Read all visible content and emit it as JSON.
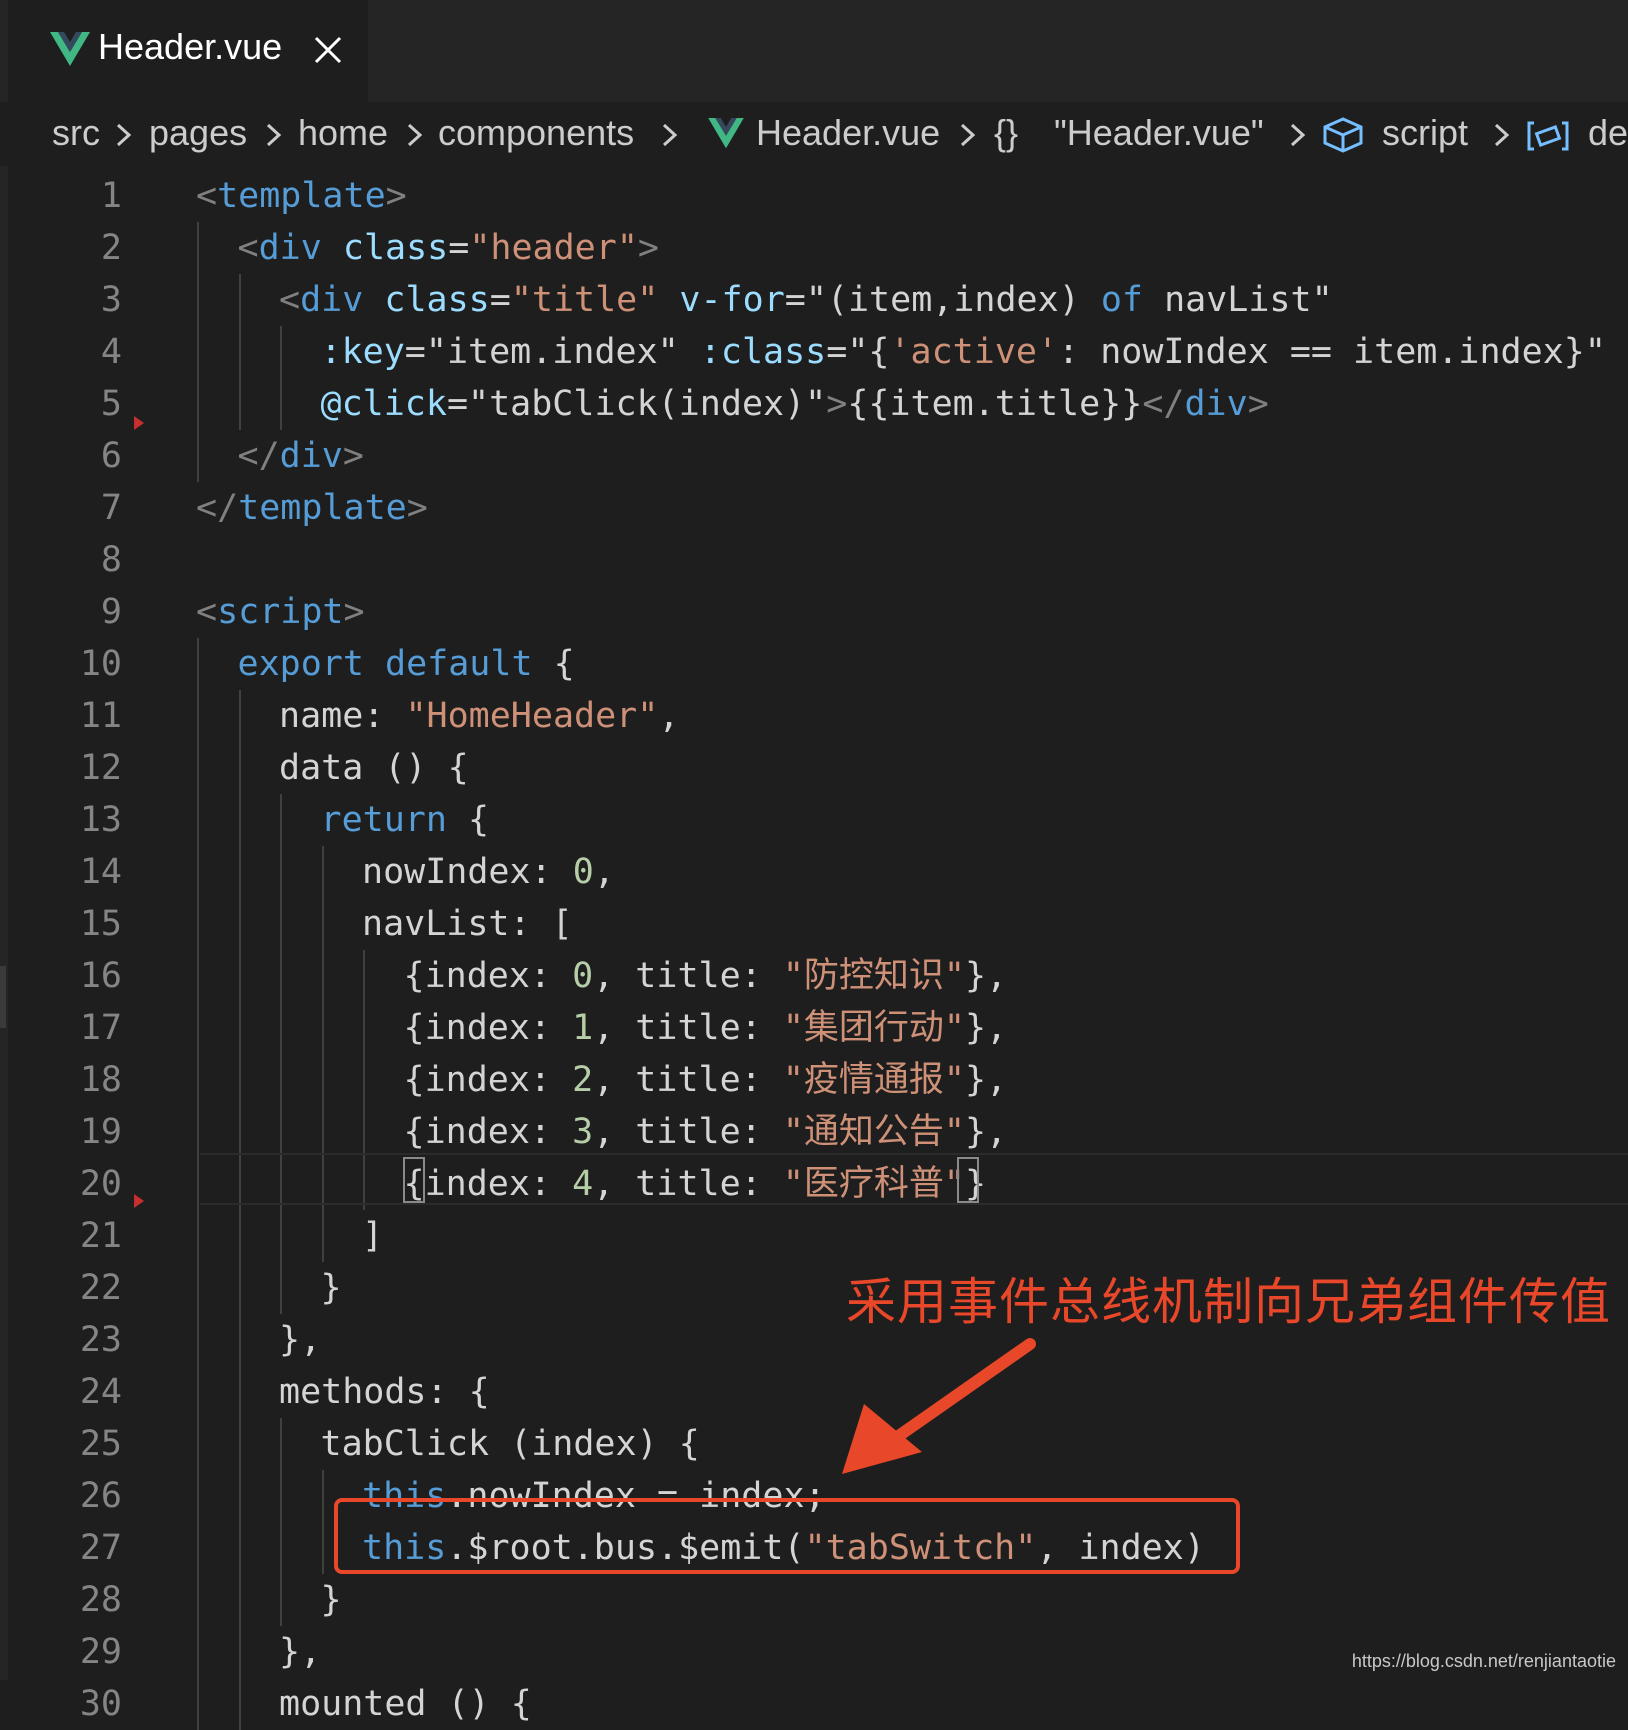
{
  "tab": {
    "label": "Header.vue",
    "vue_icon": "vue-logo-icon",
    "close_icon": "close-icon"
  },
  "breadcrumb": {
    "items": [
      "src",
      "pages",
      "home",
      "components",
      "Header.vue",
      "{}",
      "\"Header.vue\"",
      "script",
      "de"
    ]
  },
  "colors": {
    "annotation": "#e8472a",
    "vue_green": "#41b883",
    "background": "#1e1e1e"
  },
  "lines": [
    {
      "n": "1",
      "indent": 0,
      "tokens": [
        [
          "t-tag",
          "<"
        ],
        [
          "t-name",
          "template"
        ],
        [
          "t-tag",
          ">"
        ]
      ]
    },
    {
      "n": "2",
      "indent": 1,
      "tokens": [
        [
          "t-tag",
          "<"
        ],
        [
          "t-name",
          "div"
        ],
        [
          "t-prop",
          " "
        ],
        [
          "t-attr",
          "class"
        ],
        [
          "t-prop",
          "="
        ],
        [
          "t-str",
          "\"header\""
        ],
        [
          "t-tag",
          ">"
        ]
      ]
    },
    {
      "n": "3",
      "indent": 2,
      "tokens": [
        [
          "t-tag",
          "<"
        ],
        [
          "t-name",
          "div"
        ],
        [
          "t-prop",
          " "
        ],
        [
          "t-attr",
          "class"
        ],
        [
          "t-prop",
          "="
        ],
        [
          "t-str",
          "\"title\""
        ],
        [
          "t-prop",
          " "
        ],
        [
          "t-attr",
          "v-for"
        ],
        [
          "t-prop",
          "=\"(item,index) "
        ],
        [
          "t-kw",
          "of"
        ],
        [
          "t-prop",
          " navList\""
        ]
      ]
    },
    {
      "n": "4",
      "indent": 3,
      "tokens": [
        [
          "t-attr",
          ":key"
        ],
        [
          "t-prop",
          "=\"item.index\" "
        ],
        [
          "t-attr",
          ":class"
        ],
        [
          "t-prop",
          "=\"{"
        ],
        [
          "t-str",
          "'active'"
        ],
        [
          "t-prop",
          ": nowIndex == item.index}\""
        ]
      ]
    },
    {
      "n": "5",
      "indent": 3,
      "tokens": [
        [
          "t-attr",
          "@click"
        ],
        [
          "t-prop",
          "=\"tabClick(index)\""
        ],
        [
          "t-tag",
          ">"
        ],
        [
          "t-prop",
          "{{item.title}}"
        ],
        [
          "t-tag",
          "</"
        ],
        [
          "t-name",
          "div"
        ],
        [
          "t-tag",
          ">"
        ]
      ]
    },
    {
      "n": "6",
      "indent": 1,
      "tokens": [
        [
          "t-tag",
          "</"
        ],
        [
          "t-name",
          "div"
        ],
        [
          "t-tag",
          ">"
        ]
      ]
    },
    {
      "n": "7",
      "indent": 0,
      "tokens": [
        [
          "t-tag",
          "</"
        ],
        [
          "t-name",
          "template"
        ],
        [
          "t-tag",
          ">"
        ]
      ]
    },
    {
      "n": "8",
      "indent": 0,
      "tokens": []
    },
    {
      "n": "9",
      "indent": 0,
      "tokens": [
        [
          "t-tag",
          "<"
        ],
        [
          "t-name",
          "script"
        ],
        [
          "t-tag",
          ">"
        ]
      ]
    },
    {
      "n": "10",
      "indent": 1,
      "tokens": [
        [
          "t-kw",
          "export"
        ],
        [
          "t-prop",
          " "
        ],
        [
          "t-kw",
          "default"
        ],
        [
          "t-prop",
          " {"
        ]
      ]
    },
    {
      "n": "11",
      "indent": 2,
      "tokens": [
        [
          "t-prop",
          "name: "
        ],
        [
          "t-str",
          "\"HomeHeader\""
        ],
        [
          "t-prop",
          ","
        ]
      ]
    },
    {
      "n": "12",
      "indent": 2,
      "tokens": [
        [
          "t-prop",
          "data () {"
        ]
      ]
    },
    {
      "n": "13",
      "indent": 3,
      "tokens": [
        [
          "t-kw",
          "return"
        ],
        [
          "t-prop",
          " {"
        ]
      ]
    },
    {
      "n": "14",
      "indent": 4,
      "tokens": [
        [
          "t-prop",
          "nowIndex: "
        ],
        [
          "t-num",
          "0"
        ],
        [
          "t-prop",
          ","
        ]
      ]
    },
    {
      "n": "15",
      "indent": 4,
      "tokens": [
        [
          "t-prop",
          "navList: ["
        ]
      ]
    },
    {
      "n": "16",
      "indent": 5,
      "tokens": [
        [
          "t-prop",
          "{index: "
        ],
        [
          "t-num",
          "0"
        ],
        [
          "t-prop",
          ", title: "
        ],
        [
          "t-str",
          "\"防控知识\""
        ],
        [
          "t-prop",
          "},"
        ]
      ]
    },
    {
      "n": "17",
      "indent": 5,
      "tokens": [
        [
          "t-prop",
          "{index: "
        ],
        [
          "t-num",
          "1"
        ],
        [
          "t-prop",
          ", title: "
        ],
        [
          "t-str",
          "\"集团行动\""
        ],
        [
          "t-prop",
          "},"
        ]
      ]
    },
    {
      "n": "18",
      "indent": 5,
      "tokens": [
        [
          "t-prop",
          "{index: "
        ],
        [
          "t-num",
          "2"
        ],
        [
          "t-prop",
          ", title: "
        ],
        [
          "t-str",
          "\"疫情通报\""
        ],
        [
          "t-prop",
          "},"
        ]
      ]
    },
    {
      "n": "19",
      "indent": 5,
      "tokens": [
        [
          "t-prop",
          "{index: "
        ],
        [
          "t-num",
          "3"
        ],
        [
          "t-prop",
          ", title: "
        ],
        [
          "t-str",
          "\"通知公告\""
        ],
        [
          "t-prop",
          "},"
        ]
      ]
    },
    {
      "n": "20",
      "indent": 5,
      "tokens": [
        [
          "t-prop",
          "{index: "
        ],
        [
          "t-num",
          "4"
        ],
        [
          "t-prop",
          ", title: "
        ],
        [
          "t-str",
          "\"医疗科普\""
        ],
        [
          "t-prop",
          "}"
        ]
      ]
    },
    {
      "n": "21",
      "indent": 4,
      "tokens": [
        [
          "t-prop",
          "]"
        ]
      ]
    },
    {
      "n": "22",
      "indent": 3,
      "tokens": [
        [
          "t-prop",
          "}"
        ]
      ]
    },
    {
      "n": "23",
      "indent": 2,
      "tokens": [
        [
          "t-prop",
          "},"
        ]
      ]
    },
    {
      "n": "24",
      "indent": 2,
      "tokens": [
        [
          "t-prop",
          "methods: {"
        ]
      ]
    },
    {
      "n": "25",
      "indent": 3,
      "tokens": [
        [
          "t-prop",
          "tabClick (index) {"
        ]
      ]
    },
    {
      "n": "26",
      "indent": 4,
      "tokens": [
        [
          "t-kw",
          "this"
        ],
        [
          "t-prop",
          ".nowIndex = index;"
        ]
      ]
    },
    {
      "n": "27",
      "indent": 4,
      "tokens": [
        [
          "t-kw",
          "this"
        ],
        [
          "t-prop",
          ".$root.bus.$emit("
        ],
        [
          "t-str",
          "\"tabSwitch\""
        ],
        [
          "t-prop",
          ", index)"
        ]
      ]
    },
    {
      "n": "28",
      "indent": 3,
      "tokens": [
        [
          "t-prop",
          "}"
        ]
      ]
    },
    {
      "n": "29",
      "indent": 2,
      "tokens": [
        [
          "t-prop",
          "},"
        ]
      ]
    },
    {
      "n": "30",
      "indent": 2,
      "tokens": [
        [
          "t-prop",
          "mounted () {"
        ]
      ]
    }
  ],
  "annotation": {
    "text": "采用事件总线机制向兄弟组件传值"
  },
  "watermark": "https://blog.csdn.net/renjiantaotie"
}
